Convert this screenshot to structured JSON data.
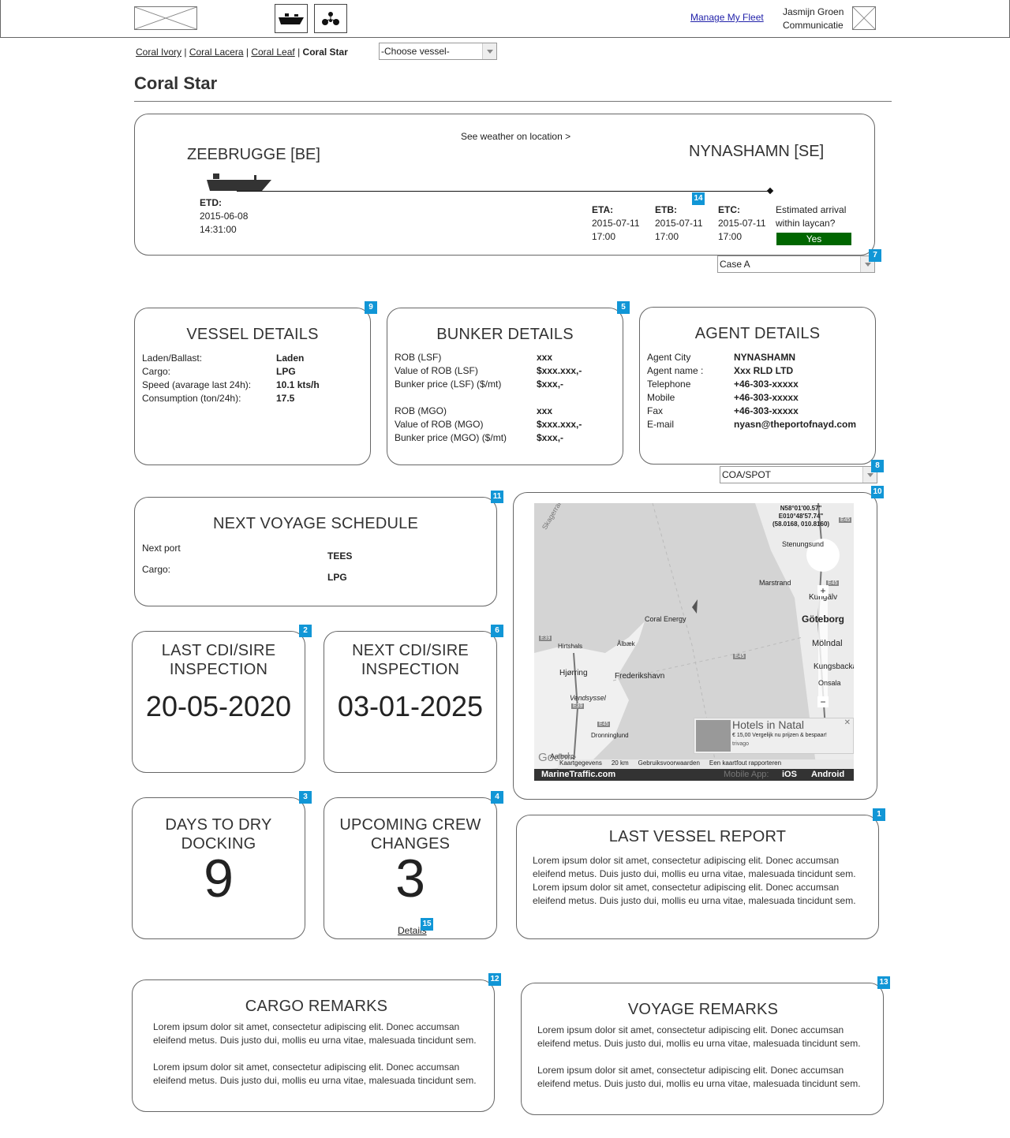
{
  "header": {
    "manage_link": "Manage My Fleet",
    "user_name": "Jasmijn Groen",
    "user_company": "Communicatie",
    "icons": [
      "ship-icon",
      "network-icon"
    ]
  },
  "breadcrumb": {
    "items": [
      "Coral Ivory",
      "Coral Lacera",
      "Coral Leaf"
    ],
    "current": "Coral Star",
    "separator": "|"
  },
  "vessel_select": {
    "value": "-Choose vessel-"
  },
  "page_title": "Coral Star",
  "voyage": {
    "weather_link": "See weather on location >",
    "from_port": "ZEEBRUGGE [BE]",
    "to_port": "NYNASHAMN [SE]",
    "etd_label": "ETD:",
    "etd_date": "2015-06-08",
    "etd_time": "14:31:00",
    "eta_label": "ETA:",
    "eta_date": "2015-07-11",
    "eta_time": "17:00",
    "etb_label": "ETB:",
    "etb_date": "2015-07-11",
    "etb_time": "17:00",
    "etc_label": "ETC:",
    "etc_date": "2015-07-11",
    "etc_time": "17:00",
    "laycan_q1": "Estimated arrival",
    "laycan_q2": "within laycan?",
    "laycan_value": "Yes",
    "laycan_color": "#006600",
    "badge": "14"
  },
  "case_select": {
    "value": "Case A",
    "badge": "7"
  },
  "vessel_details": {
    "title": "VESSEL DETAILS",
    "badge": "9",
    "rows": [
      {
        "label": "Laden/Ballast:",
        "value": "Laden"
      },
      {
        "label": "Cargo:",
        "value": "LPG"
      },
      {
        "label": "Speed (avarage last 24h):",
        "value": "10.1 kts/h"
      },
      {
        "label": "Consumption (ton/24h):",
        "value": "17.5"
      }
    ]
  },
  "bunker_details": {
    "title": "BUNKER DETAILS",
    "badge": "5",
    "rows": [
      {
        "label": "ROB (LSF)",
        "value": "xxx"
      },
      {
        "label": "Value of ROB (LSF)",
        "value": "$xxx.xxx,-"
      },
      {
        "label": "Bunker price  (LSF) ($/mt)",
        "value": "$xxx,-"
      },
      {
        "label": "ROB (MGO)",
        "value": "xxx"
      },
      {
        "label": "Value of ROB (MGO)",
        "value": "$xxx.xxx,-"
      },
      {
        "label": "Bunker price  (MGO) ($/mt)",
        "value": "$xxx,-"
      }
    ]
  },
  "agent_details": {
    "title": "AGENT DETAILS",
    "rows": [
      {
        "label": "Agent City",
        "value": "NYNASHAMN"
      },
      {
        "label": "Agent name :",
        "value": "Xxx RLD LTD"
      },
      {
        "label": "Telephone",
        "value": "+46-303-xxxxx"
      },
      {
        "label": "Mobile",
        "value": "+46-303-xxxxx"
      },
      {
        "label": "Fax",
        "value": "+46-303-xxxxx"
      },
      {
        "label": "E-mail",
        "value": "nyasn@theportofnayd.com"
      }
    ]
  },
  "coa_select": {
    "value": "COA/SPOT",
    "badge": "8"
  },
  "next_voyage": {
    "title": "NEXT VOYAGE SCHEDULE",
    "badge": "11",
    "rows": [
      {
        "label": "Next port",
        "value": "TEES"
      },
      {
        "label": "Cargo:",
        "value": "LPG"
      }
    ]
  },
  "map": {
    "badge": "10",
    "coords1": "N58°01'00.57\"",
    "coords2": "E010°48'57.74\"",
    "coords3": "(58.0168, 010.8160)",
    "vessel_label": "Coral Energy",
    "places": [
      "Skagerrak",
      "Stenungsund",
      "Marstrand",
      "Kungälv",
      "Göteborg",
      "Mölndal",
      "Kungsbacka",
      "Onsala",
      "Hirtshals",
      "Ålbæk",
      "Hjørring",
      "Frederikshavn",
      "Vendsyssel",
      "Dronninglund",
      "Aalborg"
    ],
    "roads": [
      "E45",
      "E39",
      "E45",
      "E39",
      "E45",
      "E45"
    ],
    "ad_title": "Hotels in Natal",
    "ad_text": "€ 15,00 Vergelijk nu prijzen & bespaar!",
    "ad_source": "trivago",
    "footer_items": [
      "Kaartgegevens",
      "20 km",
      "Gebruiksvoorwaarden",
      "Een kaartfout rapporteren"
    ],
    "brand": "MarineTraffic.com",
    "mobile_label": "Mobile App:",
    "ios": "iOS",
    "android": "Android",
    "google": "Google"
  },
  "last_cdi": {
    "title1": "LAST CDI/SIRE",
    "title2": "INSPECTION",
    "value": "20-05-2020",
    "badge": "2"
  },
  "next_cdi": {
    "title1": "NEXT CDI/SIRE",
    "title2": "INSPECTION",
    "value": "03-01-2025",
    "badge": "6"
  },
  "dry_dock": {
    "title1": "DAYS TO DRY",
    "title2": "DOCKING",
    "value": "9",
    "badge": "3"
  },
  "crew": {
    "title1": "UPCOMING CREW",
    "title2": "CHANGES",
    "value": "3",
    "details_link": "Details",
    "badge": "4",
    "details_badge": "15"
  },
  "last_report": {
    "title": "LAST VESSEL REPORT",
    "badge": "1",
    "p1": "Lorem ipsum dolor sit amet, consectetur adipiscing elit. Donec accumsan eleifend metus. Duis justo dui, mollis eu urna vitae, malesuada tincidunt sem. Lorem ipsum dolor sit amet, consectetur adipiscing elit. Donec accumsan eleifend metus. Duis justo dui, mollis eu urna vitae, malesuada tincidunt sem."
  },
  "cargo_remarks": {
    "title": "CARGO REMARKS",
    "badge": "12",
    "p1": "Lorem ipsum dolor sit amet, consectetur adipiscing elit. Donec accumsan eleifend metus. Duis justo dui, mollis eu urna vitae, malesuada tincidunt sem.",
    "p2": "Lorem ipsum dolor sit amet, consectetur adipiscing elit. Donec accumsan eleifend metus. Duis justo dui, mollis eu urna vitae, malesuada tincidunt sem."
  },
  "voyage_remarks": {
    "title": "VOYAGE REMARKS",
    "badge": "13",
    "p1": "Lorem ipsum dolor sit amet, consectetur adipiscing elit. Donec accumsan eleifend metus. Duis justo dui, mollis eu urna vitae, malesuada tincidunt sem.",
    "p2": "Lorem ipsum dolor sit amet, consectetur adipiscing elit. Donec accumsan eleifend metus. Duis justo dui, mollis eu urna vitae, malesuada tincidunt sem."
  },
  "colors": {
    "badge": "#1196d6",
    "laycan_yes": "#006600"
  }
}
